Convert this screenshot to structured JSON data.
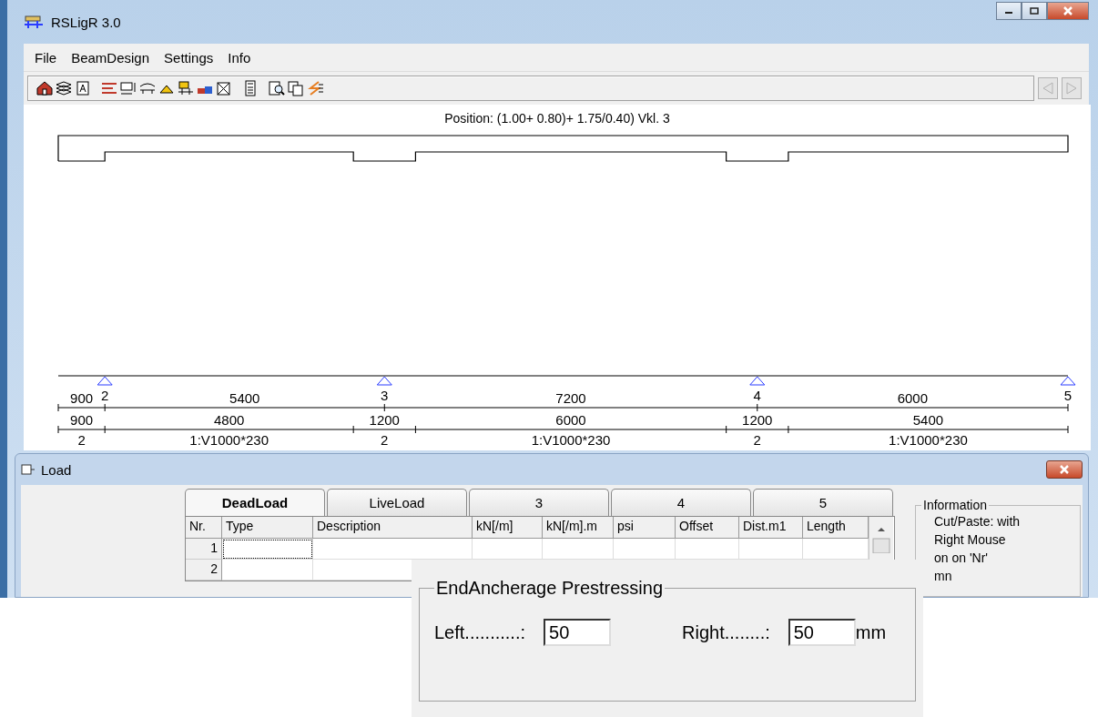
{
  "window": {
    "title": "RSLigR 3.0"
  },
  "menu": [
    "File",
    "BeamDesign",
    "Settings",
    "Info"
  ],
  "toolbar": {
    "nav_buttons": [
      {
        "disabled": true
      },
      {
        "disabled": true
      }
    ]
  },
  "drawing": {
    "position": "Position:  (1.00+ 0.80)+ 1.75/0.40) Vkl.  3",
    "spans": [
      {
        "length": "900"
      },
      {
        "length": "5400"
      },
      {
        "length": "7200"
      },
      {
        "length": "6000"
      }
    ],
    "supports": [
      {
        "label": "2"
      },
      {
        "label": "3"
      },
      {
        "label": "4"
      },
      {
        "label": "5"
      }
    ],
    "segments": [
      {
        "length": "900",
        "label": "2",
        "kind": "support"
      },
      {
        "length": "4800",
        "label": "1:V1000*230",
        "kind": "beam"
      },
      {
        "length": "1200",
        "label": "2",
        "kind": "support"
      },
      {
        "length": "6000",
        "label": "1:V1000*230",
        "kind": "beam"
      },
      {
        "length": "1200",
        "label": "2",
        "kind": "support"
      },
      {
        "length": "5400",
        "label": "1:V1000*230",
        "kind": "beam"
      }
    ]
  },
  "load_window": {
    "title": "Load",
    "tabs": [
      {
        "label": "DeadLoad",
        "selected": true
      },
      {
        "label": "LiveLoad",
        "selected": false
      },
      {
        "label": "3",
        "selected": false
      },
      {
        "label": "4",
        "selected": false
      },
      {
        "label": "5",
        "selected": false
      }
    ],
    "table": {
      "columns": [
        "Nr.",
        "Type",
        "Description",
        "kN[/m]",
        "kN[/m].m",
        "psi",
        "Offset",
        "Dist.m1",
        "Length"
      ],
      "rows": [
        {
          "nr": "1",
          "focused": true
        },
        {
          "nr": "2",
          "focused": false
        }
      ]
    },
    "information": {
      "title": "Information",
      "lines": [
        "Cut/Paste: with",
        "Right Mouse",
        "on on 'Nr'",
        "mn"
      ]
    }
  },
  "end_anchorage": {
    "title": "EndAncherage Prestressing",
    "left_label": "Left...........:",
    "left_value": "50",
    "right_label": "Right........:",
    "right_value": "50",
    "unit": "mm"
  }
}
